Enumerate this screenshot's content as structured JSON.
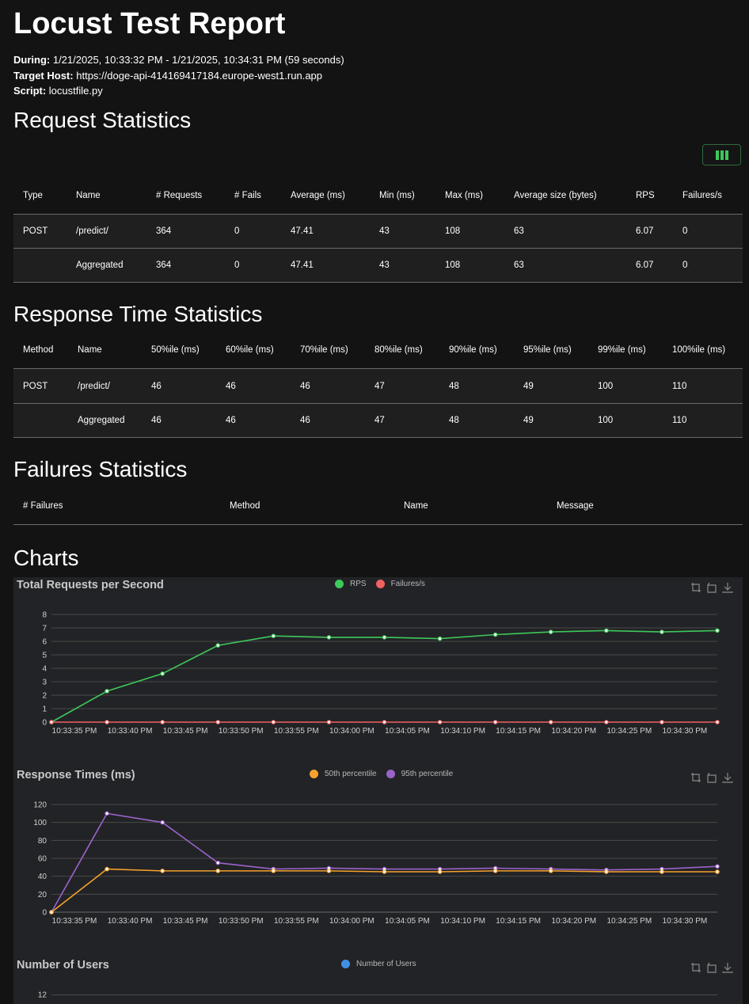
{
  "title": "Locust Test Report",
  "meta": {
    "during_label": "During:",
    "during_value": "1/21/2025, 10:33:32 PM - 1/21/2025, 10:34:31 PM (59 seconds)",
    "host_label": "Target Host:",
    "host_value": "https://doge-api-414169417184.europe-west1.run.app",
    "script_label": "Script:",
    "script_value": "locustfile.py"
  },
  "request_stats": {
    "heading": "Request Statistics",
    "columns": [
      "Type",
      "Name",
      "# Requests",
      "# Fails",
      "Average (ms)",
      "Min (ms)",
      "Max (ms)",
      "Average size (bytes)",
      "RPS",
      "Failures/s"
    ],
    "rows": [
      [
        "POST",
        "/predict/",
        "364",
        "0",
        "47.41",
        "43",
        "108",
        "63",
        "6.07",
        "0"
      ],
      [
        "",
        "Aggregated",
        "364",
        "0",
        "47.41",
        "43",
        "108",
        "63",
        "6.07",
        "0"
      ]
    ]
  },
  "response_stats": {
    "heading": "Response Time Statistics",
    "columns": [
      "Method",
      "Name",
      "50%ile (ms)",
      "60%ile (ms)",
      "70%ile (ms)",
      "80%ile (ms)",
      "90%ile (ms)",
      "95%ile (ms)",
      "99%ile (ms)",
      "100%ile (ms)"
    ],
    "rows": [
      [
        "POST",
        "/predict/",
        "46",
        "46",
        "46",
        "47",
        "48",
        "49",
        "100",
        "110"
      ],
      [
        "",
        "Aggregated",
        "46",
        "46",
        "46",
        "47",
        "48",
        "49",
        "100",
        "110"
      ]
    ]
  },
  "failures_stats": {
    "heading": "Failures Statistics",
    "columns": [
      "# Failures",
      "Method",
      "Name",
      "Message"
    ]
  },
  "charts_heading": "Charts",
  "colors": {
    "rps": "#3dc95a",
    "failures": "#f06262",
    "p50": "#f7a12e",
    "p95": "#9a63c9",
    "users": "#3f91e6",
    "grid": "#4a4a4a"
  },
  "chart_data": [
    {
      "type": "line",
      "title": "Total Requests per Second",
      "x": [
        "10:33:35 PM",
        "10:33:40 PM",
        "10:33:45 PM",
        "10:33:50 PM",
        "10:33:55 PM",
        "10:34:00 PM",
        "10:34:05 PM",
        "10:34:10 PM",
        "10:34:15 PM",
        "10:34:20 PM",
        "10:34:25 PM",
        "10:34:30 PM"
      ],
      "series": [
        {
          "name": "RPS",
          "values": [
            0,
            2.3,
            3.6,
            5.7,
            6.4,
            6.3,
            6.3,
            6.2,
            6.5,
            6.7,
            6.8,
            6.7,
            6.8
          ]
        },
        {
          "name": "Failures/s",
          "values": [
            0,
            0,
            0,
            0,
            0,
            0,
            0,
            0,
            0,
            0,
            0,
            0,
            0
          ]
        }
      ],
      "yticks": [
        0,
        1,
        2,
        3,
        4,
        5,
        6,
        7,
        8
      ],
      "ylim": [
        0,
        8
      ],
      "legend": "top-center",
      "grid": true
    },
    {
      "type": "line",
      "title": "Response Times (ms)",
      "x": [
        "10:33:35 PM",
        "10:33:40 PM",
        "10:33:45 PM",
        "10:33:50 PM",
        "10:33:55 PM",
        "10:34:00 PM",
        "10:34:05 PM",
        "10:34:10 PM",
        "10:34:15 PM",
        "10:34:20 PM",
        "10:34:25 PM",
        "10:34:30 PM"
      ],
      "series": [
        {
          "name": "50th percentile",
          "values": [
            0,
            48,
            46,
            46,
            46,
            46,
            45,
            45,
            46,
            46,
            45,
            45,
            45
          ]
        },
        {
          "name": "95th percentile",
          "values": [
            0,
            110,
            100,
            55,
            48,
            49,
            48,
            48,
            49,
            48,
            47,
            48,
            51
          ]
        }
      ],
      "yticks": [
        0,
        20,
        40,
        60,
        80,
        100,
        120
      ],
      "ylim": [
        0,
        120
      ],
      "legend": "top-center",
      "grid": true
    },
    {
      "type": "line",
      "title": "Number of Users",
      "series": [
        {
          "name": "Number of Users",
          "values": []
        }
      ],
      "yticks": [
        12
      ],
      "legend": "top-center",
      "grid": true
    }
  ]
}
